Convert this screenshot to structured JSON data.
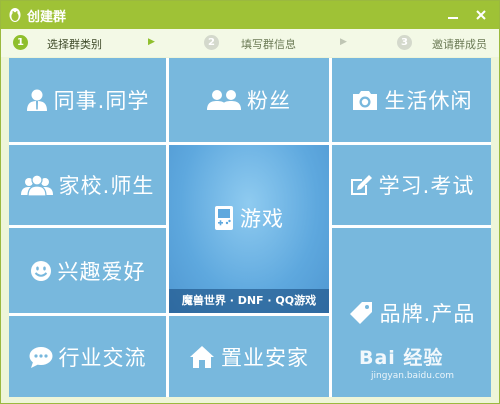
{
  "window": {
    "title": "创建群"
  },
  "steps": [
    {
      "num": "1",
      "label": "选择群类别",
      "active": true
    },
    {
      "num": "2",
      "label": "填写群信息",
      "active": false
    },
    {
      "num": "3",
      "label": "邀请群成员",
      "active": false
    }
  ],
  "tiles": {
    "colleagues": "同事.同学",
    "fans": "粉丝",
    "life": "生活休闲",
    "family_school": "家校.师生",
    "study_exam": "学习.考试",
    "interests": "兴趣爱好",
    "games": "游戏",
    "games_caption": "魔兽世界 · DNF · QQ游戏",
    "brand_product": "品牌.产品",
    "industry": "行业交流",
    "real_estate": "置业安家"
  },
  "watermark": {
    "logo": "Bai 经验",
    "url": "jingyan.baidu.com"
  },
  "colors": {
    "accent": "#9fc236",
    "tile": "#78b8dd",
    "game_tile": "#5ea8de"
  }
}
